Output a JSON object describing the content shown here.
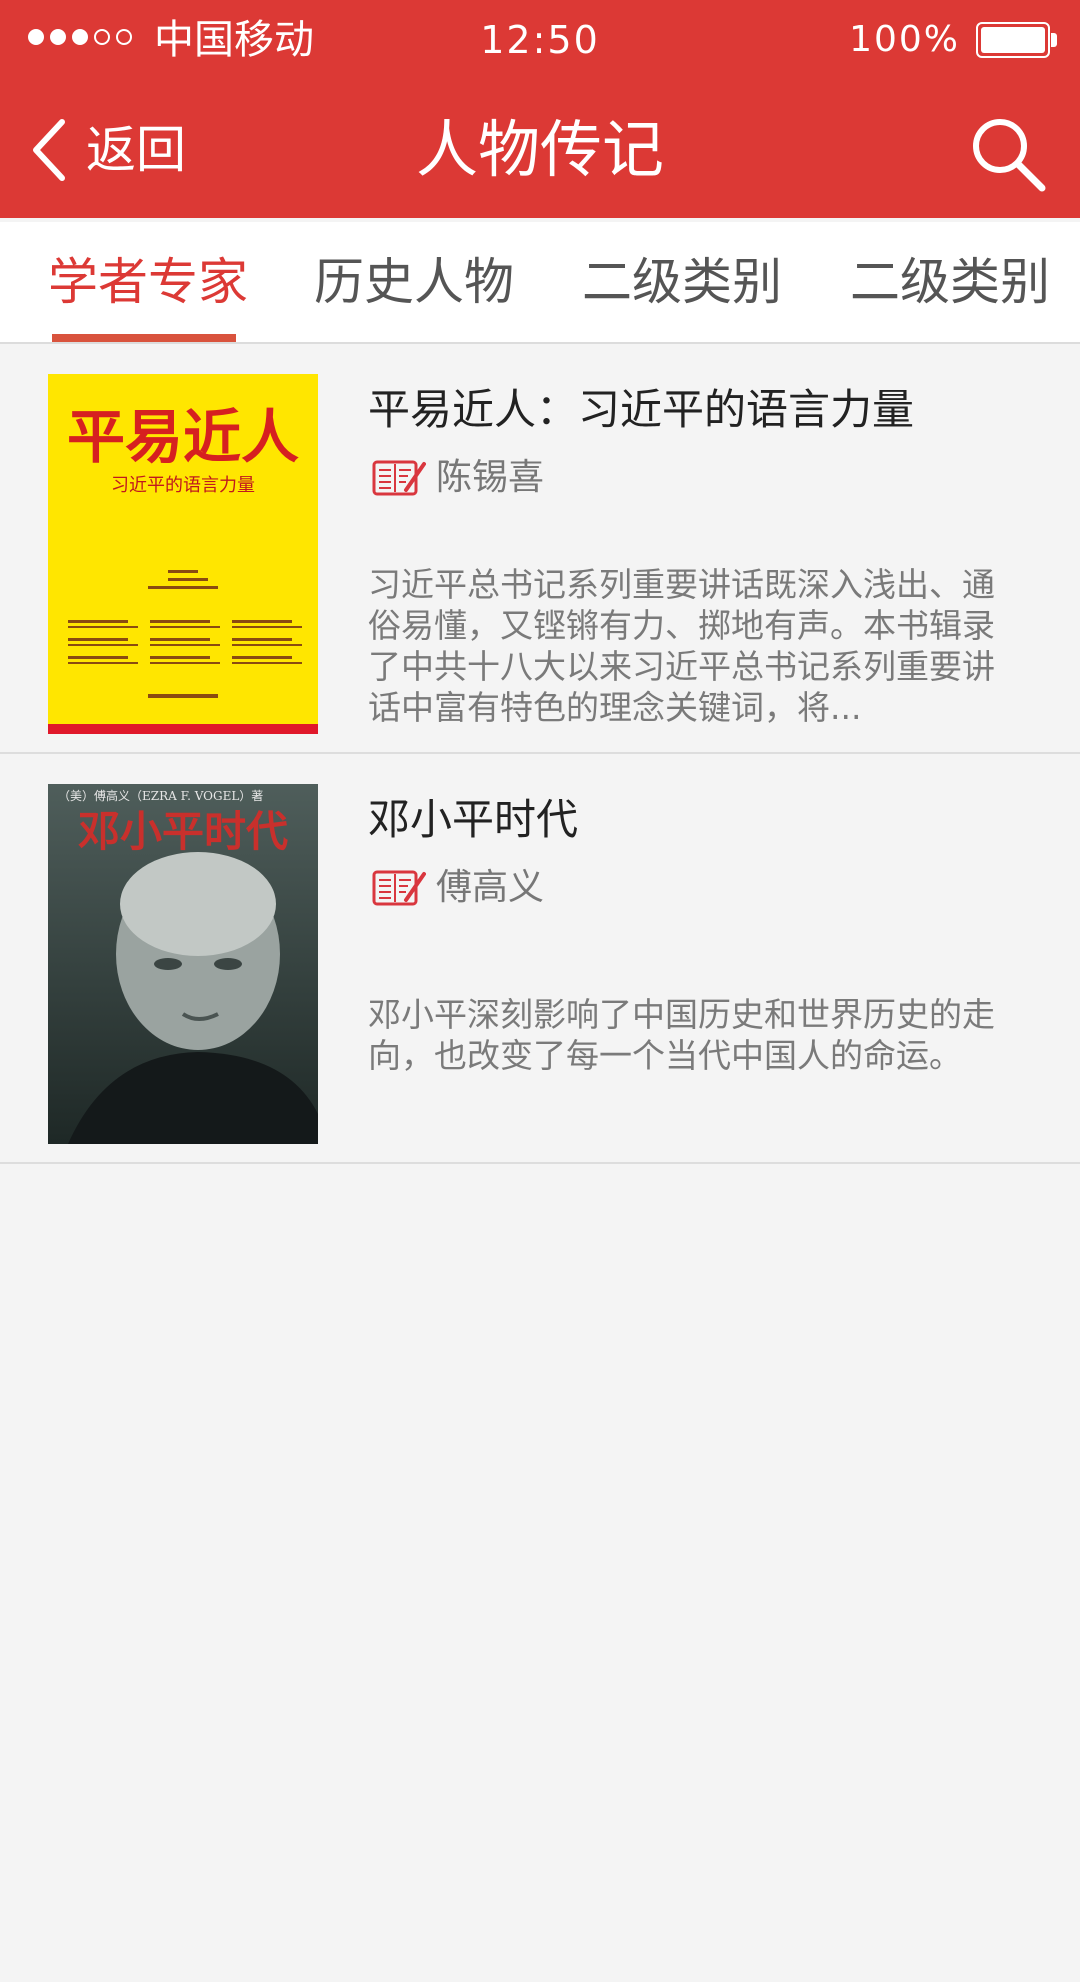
{
  "status_bar": {
    "carrier": "中国移动",
    "time": "12:50",
    "battery": "100%"
  },
  "nav": {
    "back_label": "返回",
    "title": "人物传记"
  },
  "tabs": [
    {
      "label": "学者专家",
      "active": true
    },
    {
      "label": "历史人物",
      "active": false
    },
    {
      "label": "二级类别",
      "active": false
    },
    {
      "label": "二级类别",
      "active": false
    }
  ],
  "books": [
    {
      "title": "平易近人：习近平的语言力量",
      "author": "陈锡喜",
      "description": "习近平总书记系列重要讲话既深入浅出、通俗易懂，又铿锵有力、掷地有声。本书辑录了中共十八大以来习近平总书记系列重要讲话中富有特色的理念关键词，将...",
      "cover": {
        "title": "平易近人",
        "subtitle": "习近平的语言力量"
      }
    },
    {
      "title": "邓小平时代",
      "author": "傅高义",
      "description": "邓小平深刻影响了中国历史和世界历史的走向，也改变了每一个当代中国人的命运。",
      "cover": {
        "author_line": "（美）傅高义（EZRA F. VOGEL）著",
        "title": "邓小平时代"
      }
    }
  ],
  "colors": {
    "brand_red": "#dc3935",
    "tab_underline": "#d9533d",
    "background": "#f4f4f4"
  },
  "icons": {
    "back": "chevron-left-icon",
    "search": "search-icon",
    "author": "author-book-icon"
  }
}
